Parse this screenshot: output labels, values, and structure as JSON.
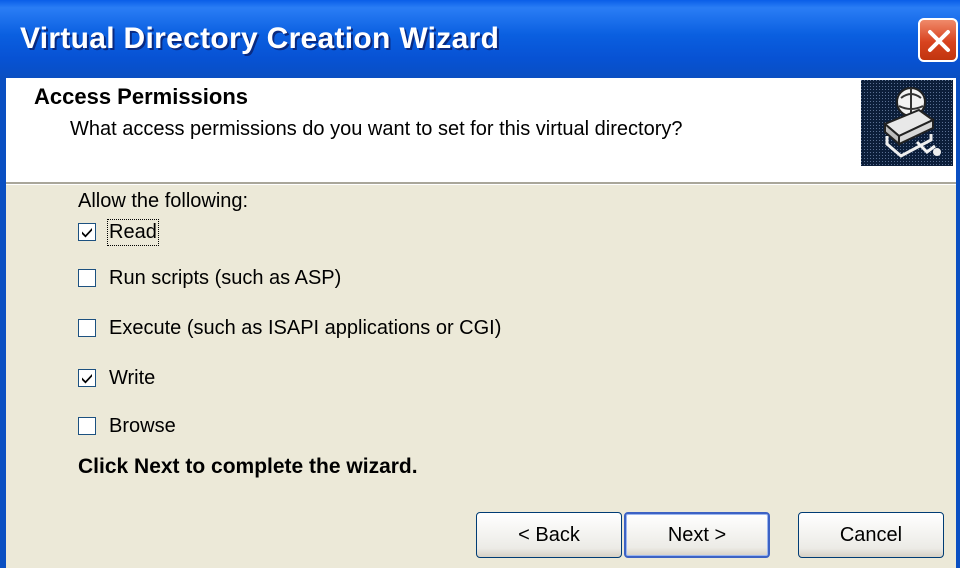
{
  "window": {
    "title": "Virtual Directory Creation Wizard",
    "close_icon": "close-icon"
  },
  "header": {
    "title": "Access Permissions",
    "subtitle": "What access permissions do you want to set for this virtual directory?",
    "icon": "wizard-book-icon"
  },
  "permissions": {
    "label": "Allow the following:",
    "items": [
      {
        "label": "Read",
        "checked": true
      },
      {
        "label": "Run scripts (such as ASP)",
        "checked": false
      },
      {
        "label": "Execute (such as ISAPI applications or CGI)",
        "checked": false
      },
      {
        "label": "Write",
        "checked": true
      },
      {
        "label": "Browse",
        "checked": false
      }
    ]
  },
  "footer_message": "Click Next to complete the wizard.",
  "buttons": {
    "back": "< Back",
    "next": "Next >",
    "cancel": "Cancel"
  },
  "colors": {
    "titlebar": "#0a5ee8",
    "close": "#d8431f",
    "dialog_bg": "#ece9d8"
  }
}
